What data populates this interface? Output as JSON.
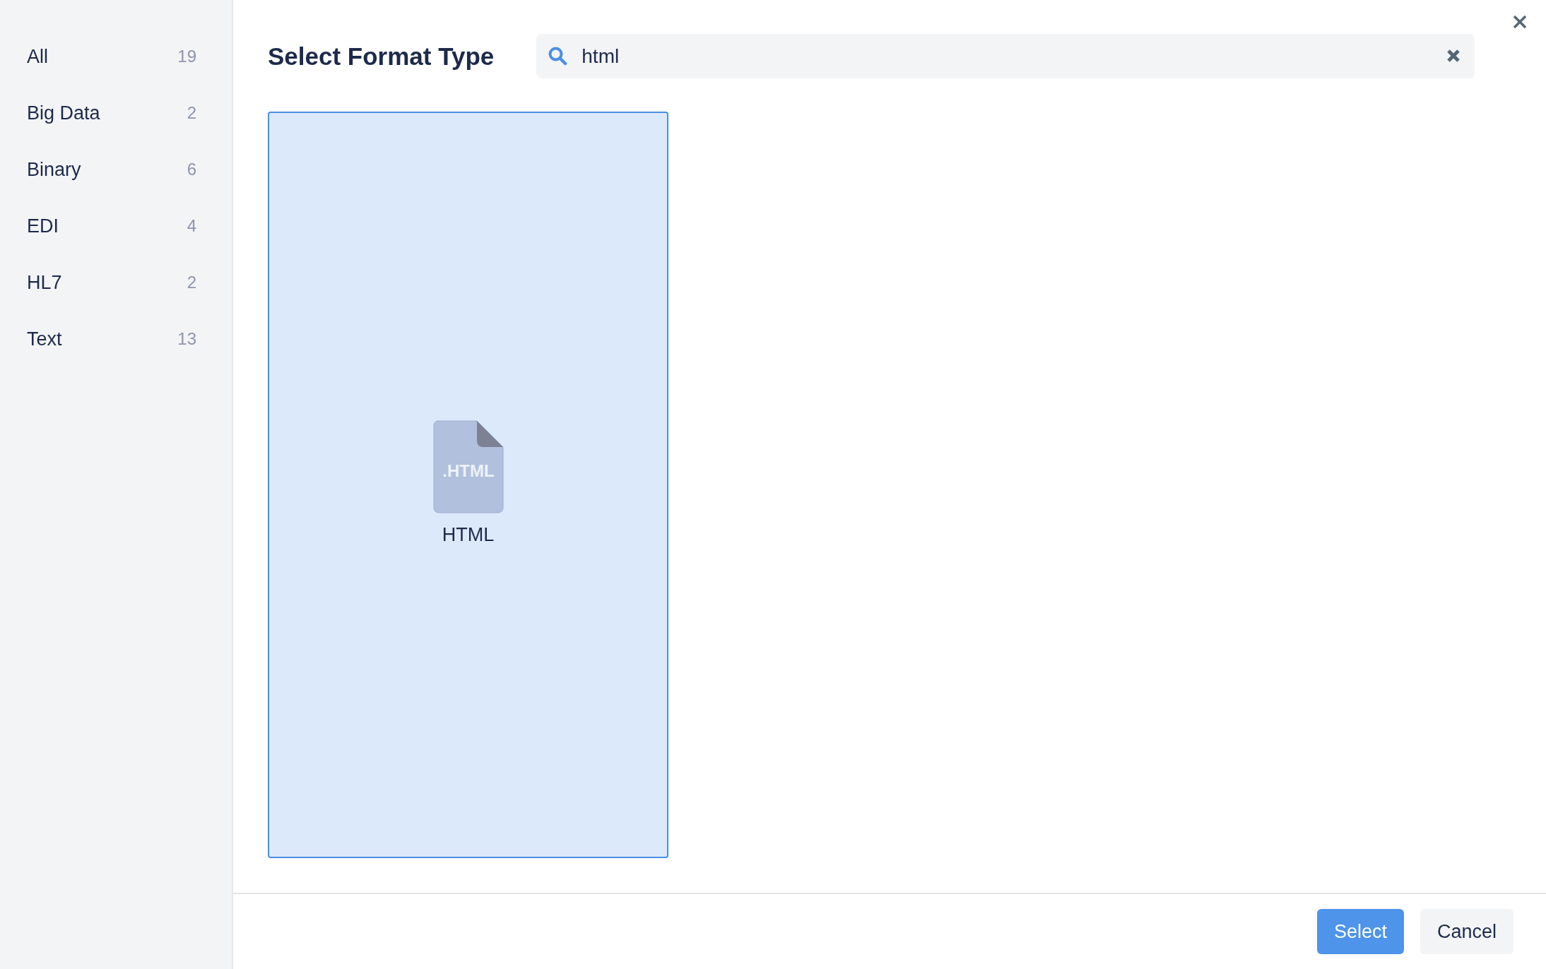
{
  "sidebar": {
    "items": [
      {
        "label": "All",
        "count": "19"
      },
      {
        "label": "Big Data",
        "count": "2"
      },
      {
        "label": "Binary",
        "count": "6"
      },
      {
        "label": "EDI",
        "count": "4"
      },
      {
        "label": "HL7",
        "count": "2"
      },
      {
        "label": "Text",
        "count": "13"
      }
    ]
  },
  "title": "Select Format Type",
  "search": {
    "value": "html"
  },
  "formats": [
    {
      "name": "HTML",
      "icon_text": ".HTML",
      "selected": true
    }
  ],
  "buttons": [
    {
      "label": "Select",
      "kind": "primary"
    },
    {
      "label": "Cancel",
      "kind": "secondary"
    }
  ]
}
